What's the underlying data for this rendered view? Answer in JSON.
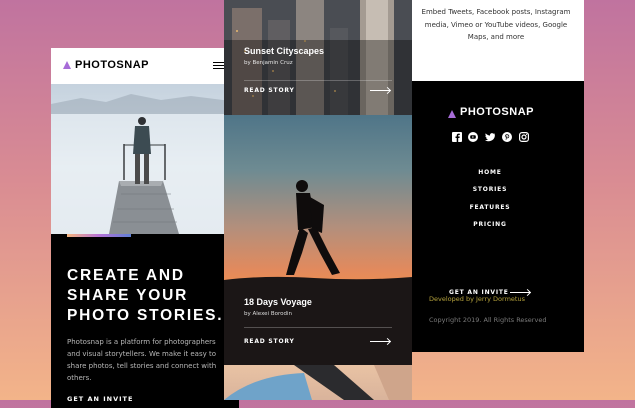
{
  "colors": {
    "accent_purple": "#a76cd8",
    "gradient_orange": "#f6b57d",
    "gradient_blue": "#5f80d6",
    "developer_text": "#b5a23c"
  },
  "home": {
    "logo": "PHOTOSNAP",
    "menu_icon": "hamburger-icon",
    "headline": [
      "CREATE AND",
      "SHARE YOUR",
      "PHOTO STORIES."
    ],
    "body": "Photosnap is a platform for photographers and visual storytellers. We make it easy to share photos, tell stories and connect with others.",
    "cta": "GET AN INVITE"
  },
  "stories": [
    {
      "title": "Sunset Cityscapes",
      "author": "by Benjamin Cruz",
      "action": "READ STORY"
    },
    {
      "title": "18 Days Voyage",
      "author": "by Alexei Borodin",
      "action": "READ STORY"
    }
  ],
  "footer": {
    "features_text": "Embed Tweets, Facebook posts, Instagram media, Vimeo or YouTube videos, Google Maps, and more",
    "logo": "PHOTOSNAP",
    "social_icons": [
      "facebook-icon",
      "youtube-icon",
      "twitter-icon",
      "pinterest-icon",
      "instagram-icon"
    ],
    "nav": [
      "HOME",
      "STORIES",
      "FEATURES",
      "PRICING"
    ],
    "cta": "GET AN INVITE",
    "developer": "Developed by Jerry Dormetus",
    "copyright": "Copyright 2019. All Rights Reserved"
  }
}
